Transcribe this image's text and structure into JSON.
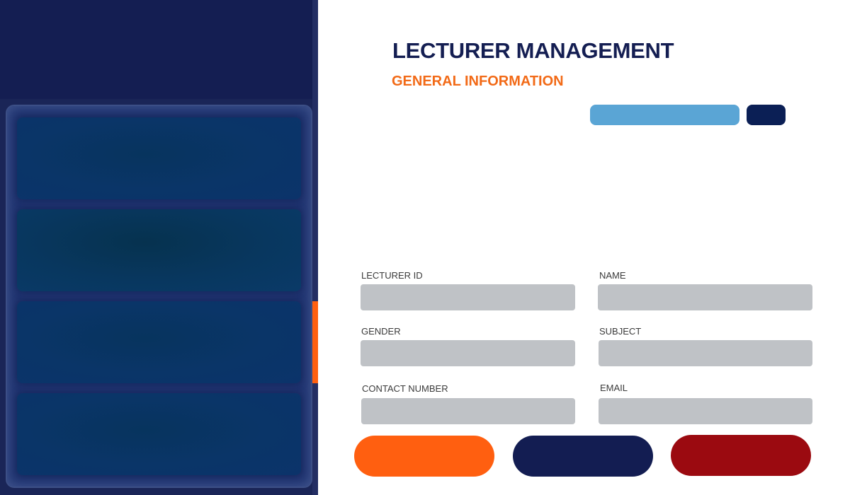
{
  "header": {
    "title": "LECTURER MANAGEMENT",
    "subtitle": "GENERAL INFORMATION"
  },
  "search": {
    "value": "",
    "button_label": ""
  },
  "sidebar": {
    "items": [
      {
        "label": ""
      },
      {
        "label": ""
      },
      {
        "label": ""
      },
      {
        "label": ""
      }
    ]
  },
  "form": {
    "fields": [
      {
        "label": "LECTURER ID",
        "value": ""
      },
      {
        "label": "NAME",
        "value": ""
      },
      {
        "label": "GENDER",
        "value": ""
      },
      {
        "label": "SUBJECT",
        "value": ""
      },
      {
        "label": "CONTACT NUMBER",
        "value": ""
      },
      {
        "label": "EMAIL",
        "value": ""
      }
    ]
  },
  "actions": {
    "primary_label": "",
    "secondary_label": "",
    "danger_label": ""
  },
  "colors": {
    "sidebar": "#1a2557",
    "title": "#141e52",
    "accent": "#ff5f10",
    "search": "#5aa5d5",
    "danger": "#9b0a10"
  }
}
